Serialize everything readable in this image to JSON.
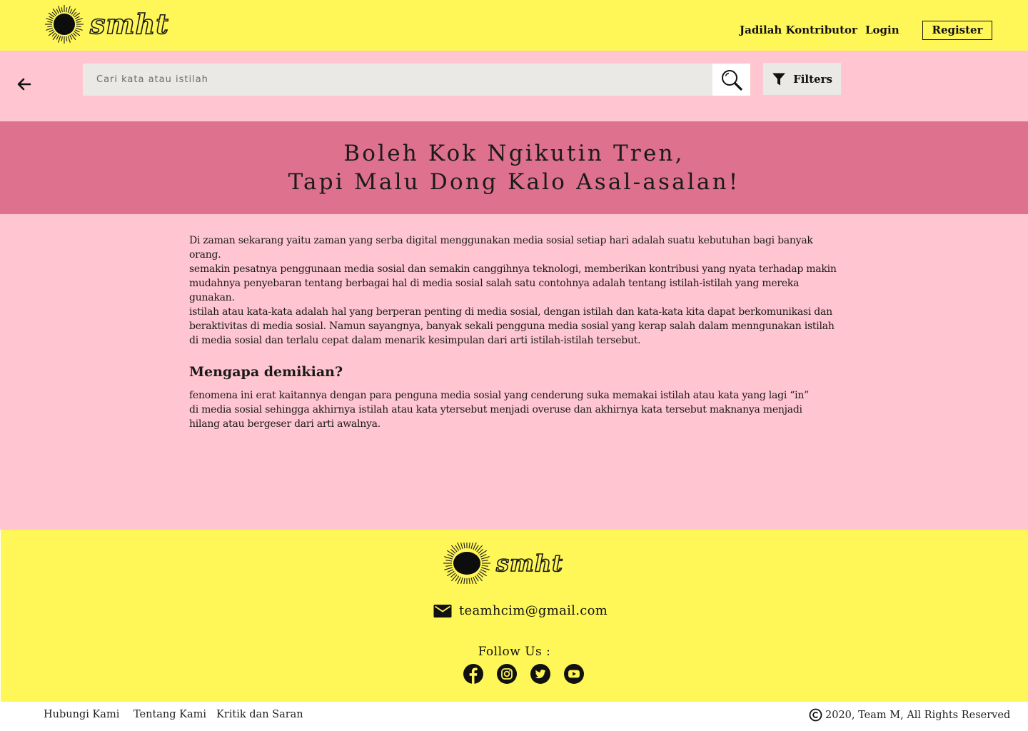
{
  "brand": {
    "name": "smht"
  },
  "nav": {
    "contributor": "Jadilah Kontributor",
    "login": "Login",
    "register": "Register"
  },
  "search": {
    "placeholder": "Cari kata atau istilah",
    "filter_label": "Filters"
  },
  "banner": {
    "line1": "Boleh Kok Ngikutin Tren,",
    "line2": "Tapi Malu Dong Kalo Asal-asalan!"
  },
  "article": {
    "intro": "Di  zaman sekarang yaitu zaman  yang serba digital menggunakan media sosial  setiap hari adalah suatu kebutuhan bagi banyak orang.\nsemakin pesatnya penggunaan media sosial dan semakin canggihnya teknologi, memberikan kontribusi yang nyata terhadap makin\nmudahnya penyebaran tentang berbagai hal di media sosial salah satu contohnya adalah tentang istilah-istilah yang mereka gunakan.\nistilah atau kata-kata adalah hal yang berperan penting di media sosial, dengan istilah dan kata-kata kita dapat berkomunikasi dan\nberaktivitas di media sosial. Namun sayangnya, banyak sekali pengguna media sosial yang kerap salah dalam menngunakan istilah\ndi media sosial dan terlalu cepat dalam menarik kesimpulan dari arti istilah-istilah tersebut.",
    "heading": "Mengapa demikian?",
    "body": "fenomena ini erat kaitannya dengan para penguna media sosial yang cenderung suka memakai istilah atau kata yang lagi “in”\ndi media sosial sehingga akhirnya istilah atau kata ytersebut menjadi overuse dan akhirnya kata tersebut maknanya menjadi\nhilang atau bergeser dari arti awalnya."
  },
  "footer": {
    "email": "teamhcim@gmail.com",
    "follow_label": "Follow Us :",
    "socials": [
      "facebook-icon",
      "instagram-icon",
      "twitter-icon",
      "youtube-icon"
    ]
  },
  "bottom": {
    "links": [
      "Hubungi Kami",
      "Tentang Kami",
      "Kritik dan Saran"
    ],
    "copyright": "2020, Team M, All Rights Reserved"
  },
  "colors": {
    "yellow": "#fff757",
    "pink_light": "#ffc5d0",
    "pink_dark": "#de718e",
    "search_bg": "#ebe9e6"
  }
}
